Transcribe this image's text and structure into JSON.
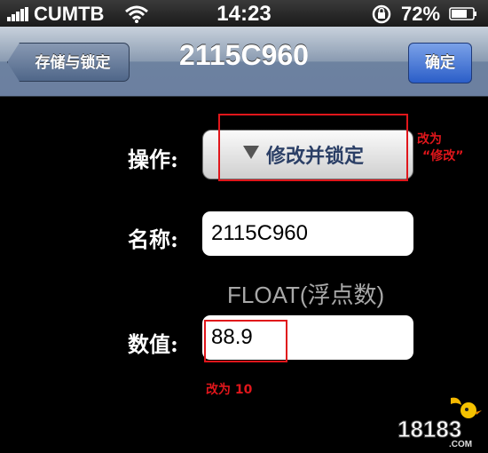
{
  "status_bar": {
    "carrier": "CUMTB",
    "time": "14:23",
    "battery": "72%"
  },
  "nav": {
    "back_label": "存储与锁定",
    "title": "2115C960",
    "confirm_label": "确定"
  },
  "form": {
    "operation": {
      "label": "操作:",
      "value": "修改并锁定"
    },
    "name": {
      "label": "名称:",
      "value": "2115C960"
    },
    "type_hint": "FLOAT(浮点数)",
    "value_field": {
      "label": "数值:",
      "value": "88.9"
    }
  },
  "annotations": {
    "operation_note_line1": "改为",
    "operation_note_line2": "“修改”",
    "value_note": "改为 10",
    "color": "#e0161b"
  },
  "watermark": {
    "text": "18183",
    "suffix": ".COM"
  },
  "icons": [
    "signal-icon",
    "wifi-icon",
    "rotation-lock-icon",
    "battery-icon",
    "dropdown-arrow-icon"
  ]
}
